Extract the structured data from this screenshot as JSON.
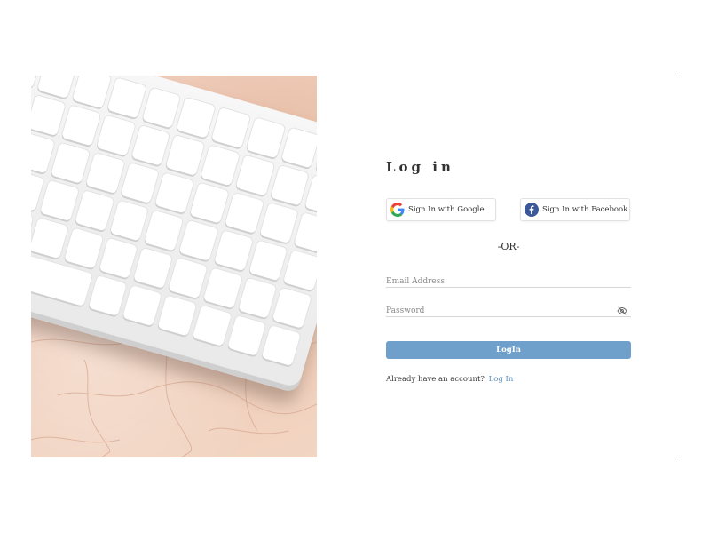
{
  "login": {
    "title": "Log in",
    "google_label": "Sign In with Google",
    "facebook_label": "Sign In with Facebook",
    "separator": "-OR-",
    "email_placeholder": "Email Address",
    "password_placeholder": "Password",
    "submit_label": "LogIn",
    "footer_text": "Already have an account?",
    "footer_link": "Log In"
  },
  "colors": {
    "primary_button": "#6f9fcb",
    "link": "#5b8fbf",
    "facebook": "#3b5998"
  },
  "icons": {
    "google": "google-g-icon",
    "facebook": "facebook-f-icon",
    "password_toggle": "eye-off-icon"
  }
}
